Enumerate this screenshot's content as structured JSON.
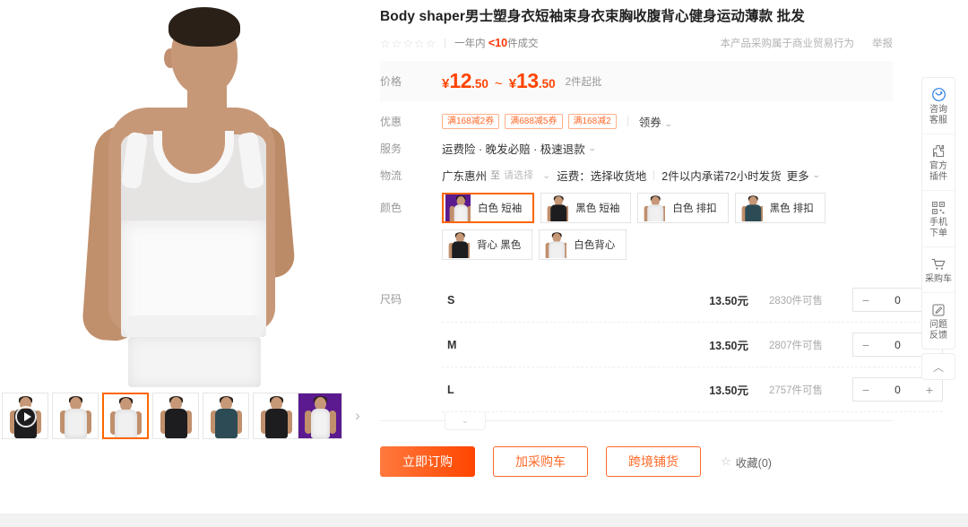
{
  "product": {
    "title": "Body shaper男士塑身衣短袖束身衣束胸收腹背心健身运动薄款 批发",
    "rating_stars": 5,
    "sales_prefix": "一年内",
    "sales_count": "<10",
    "sales_suffix": "件成交",
    "biz_note": "本产品采购属于商业贸易行为",
    "report_label": "举报"
  },
  "price": {
    "label": "价格",
    "currency": "¥",
    "low_int": "12",
    "low_dec": ".50",
    "range_sep": "~",
    "high_int": "13",
    "high_dec": ".50",
    "moq": "2件起批"
  },
  "promo": {
    "label": "优惠",
    "coupons": [
      "满168减2券",
      "满688减5券",
      "满168减2"
    ],
    "get_coupon": "领券"
  },
  "service": {
    "label": "服务",
    "text": "运费险 · 晚发必赔 · 极速退款"
  },
  "logistics": {
    "label": "物流",
    "origin": "广东惠州",
    "to": "至",
    "destination_placeholder": "请选择",
    "freight_label": "运费：",
    "freight_value": "选择收货地",
    "promise": "2件以内承诺72小时发货",
    "more": "更多"
  },
  "color": {
    "label": "颜色",
    "options": [
      {
        "name": "白色 短袖",
        "style": "white",
        "selected": true,
        "purple_bg": true
      },
      {
        "name": "黑色 短袖",
        "style": "black",
        "selected": false,
        "purple_bg": false
      },
      {
        "name": "白色 排扣",
        "style": "white",
        "selected": false,
        "purple_bg": false
      },
      {
        "name": "黑色 排扣",
        "style": "teal",
        "selected": false,
        "purple_bg": false
      },
      {
        "name": "背心 黑色",
        "style": "black",
        "selected": false,
        "purple_bg": false
      },
      {
        "name": "白色背心",
        "style": "white",
        "selected": false,
        "purple_bg": false
      }
    ]
  },
  "size": {
    "label": "尺码",
    "rows": [
      {
        "name": "S",
        "price": "13.50元",
        "stock": "2830件可售",
        "qty": "0"
      },
      {
        "name": "M",
        "price": "13.50元",
        "stock": "2807件可售",
        "qty": "0"
      },
      {
        "name": "L",
        "price": "13.50元",
        "stock": "2757件可售",
        "qty": "0"
      }
    ],
    "minus": "−",
    "plus": "+",
    "expand_icon": "⌄"
  },
  "actions": {
    "buy_now": "立即订购",
    "add_cart": "加采购车",
    "cross_border": "跨境铺货",
    "favorite": "收藏(0)",
    "favorite_icon": "☆"
  },
  "rail": {
    "items": [
      {
        "icon": "consult-service-icon",
        "line1": "咨询",
        "line2": "客服"
      },
      {
        "icon": "official-plugin-icon",
        "line1": "官方",
        "line2": "插件"
      },
      {
        "icon": "qrcode-icon",
        "line1": "手机",
        "line2": "下单"
      },
      {
        "icon": "cart-icon",
        "line1": "采购车",
        "line2": ""
      },
      {
        "icon": "feedback-icon",
        "line1": "问题",
        "line2": "反馈"
      }
    ],
    "to_top_icon": "︿"
  },
  "gallery": {
    "next_icon": "›",
    "thumbs": [
      {
        "style": "black",
        "has_play": true,
        "purple_bg": false,
        "selected": false
      },
      {
        "style": "white",
        "has_play": false,
        "purple_bg": false,
        "selected": false
      },
      {
        "style": "white",
        "has_play": false,
        "purple_bg": false,
        "selected": true
      },
      {
        "style": "black",
        "has_play": false,
        "purple_bg": false,
        "selected": false
      },
      {
        "style": "teal",
        "has_play": false,
        "purple_bg": false,
        "selected": false
      },
      {
        "style": "black",
        "has_play": false,
        "purple_bg": false,
        "selected": false
      },
      {
        "style": "white",
        "has_play": false,
        "purple_bg": true,
        "selected": false
      }
    ]
  },
  "colors_hex": {
    "accent_orange": "#ff6a29",
    "price_orange": "#ff4400",
    "hot_red": "#ff3300",
    "border_gray": "#e4e4e4"
  }
}
